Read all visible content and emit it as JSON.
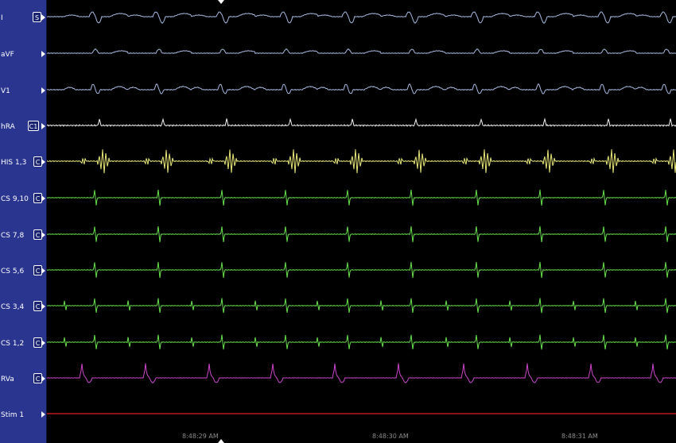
{
  "channels": [
    {
      "label": "I",
      "button": "S",
      "color": "#a8b8e0",
      "kind": "surface_wide"
    },
    {
      "label": "aVF",
      "button": "",
      "color": "#a8b8e0",
      "kind": "surface_small"
    },
    {
      "label": "V1",
      "button": "",
      "color": "#a8b8e0",
      "kind": "surface_v1"
    },
    {
      "label": "hRA",
      "button": "C1",
      "color": "#f0f0f0",
      "kind": "hra"
    },
    {
      "label": "HIS 1,3",
      "button": "C",
      "color": "#e8e878",
      "kind": "his"
    },
    {
      "label": "CS 9,10",
      "button": "C",
      "color": "#66e04a",
      "kind": "cs"
    },
    {
      "label": "CS 7,8",
      "button": "C",
      "color": "#66e04a",
      "kind": "cs"
    },
    {
      "label": "CS 5,6",
      "button": "C",
      "color": "#66e04a",
      "kind": "cs"
    },
    {
      "label": "CS 3,4",
      "button": "C",
      "color": "#66e04a",
      "kind": "cs2"
    },
    {
      "label": "CS 1,2",
      "button": "C",
      "color": "#66e04a",
      "kind": "cs2"
    },
    {
      "label": "RVa",
      "button": "C",
      "color": "#cc44cc",
      "kind": "rva"
    },
    {
      "label": "Stim 1",
      "button": "",
      "color": "#dd2020",
      "kind": "flat"
    }
  ],
  "time_labels": [
    "8:48:29 AM",
    "8:48:30 AM",
    "8:48:31 AM"
  ],
  "colors": {
    "sidebar": "#2a3590",
    "background": "#000000",
    "grid": "#2a2a2a"
  }
}
